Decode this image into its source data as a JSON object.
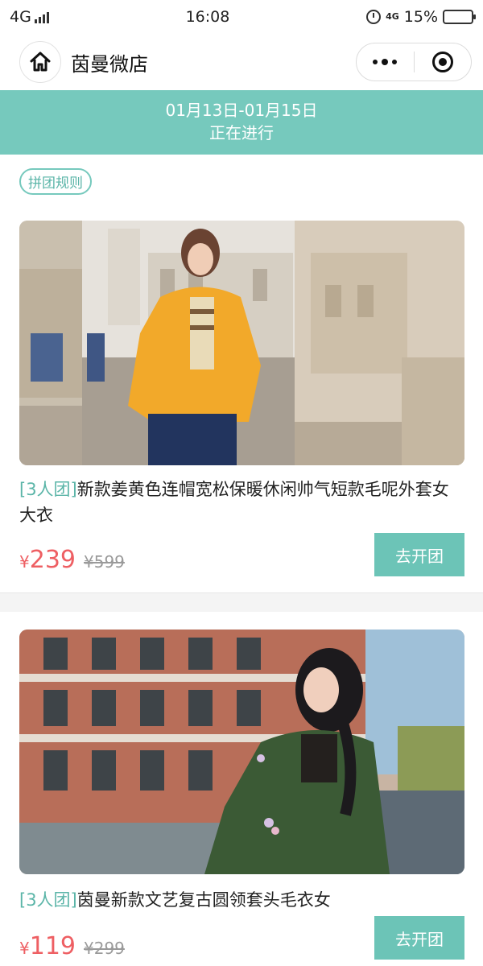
{
  "status_bar": {
    "network": "4G",
    "time": "16:08",
    "alarm_icon": "alarm-clock-icon",
    "net_small": "4G",
    "battery": "15%",
    "battery_level": 0.15
  },
  "nav": {
    "title": "茵曼微店",
    "home_icon": "home-icon",
    "more_icon": "more-dots-icon",
    "close_icon": "close-target-icon"
  },
  "banner": {
    "date_range": "01月13日-01月15日",
    "status": "正在进行"
  },
  "rules_button": "拼团规则",
  "colors": {
    "accent": "#76c9bd",
    "price": "#ee5f63"
  },
  "products": [
    {
      "tag": "[3人团]",
      "name": "新款姜黄色连帽宽松保暖休闲帅气短款毛呢外套女大衣",
      "currency": "¥",
      "price": "239",
      "original_price": "¥599",
      "button": "去开团"
    },
    {
      "tag": "[3人团]",
      "name": "茵曼新款文艺复古圆领套头毛衣女",
      "currency": "¥",
      "price": "119",
      "original_price": "¥299",
      "button": "去开团"
    }
  ]
}
